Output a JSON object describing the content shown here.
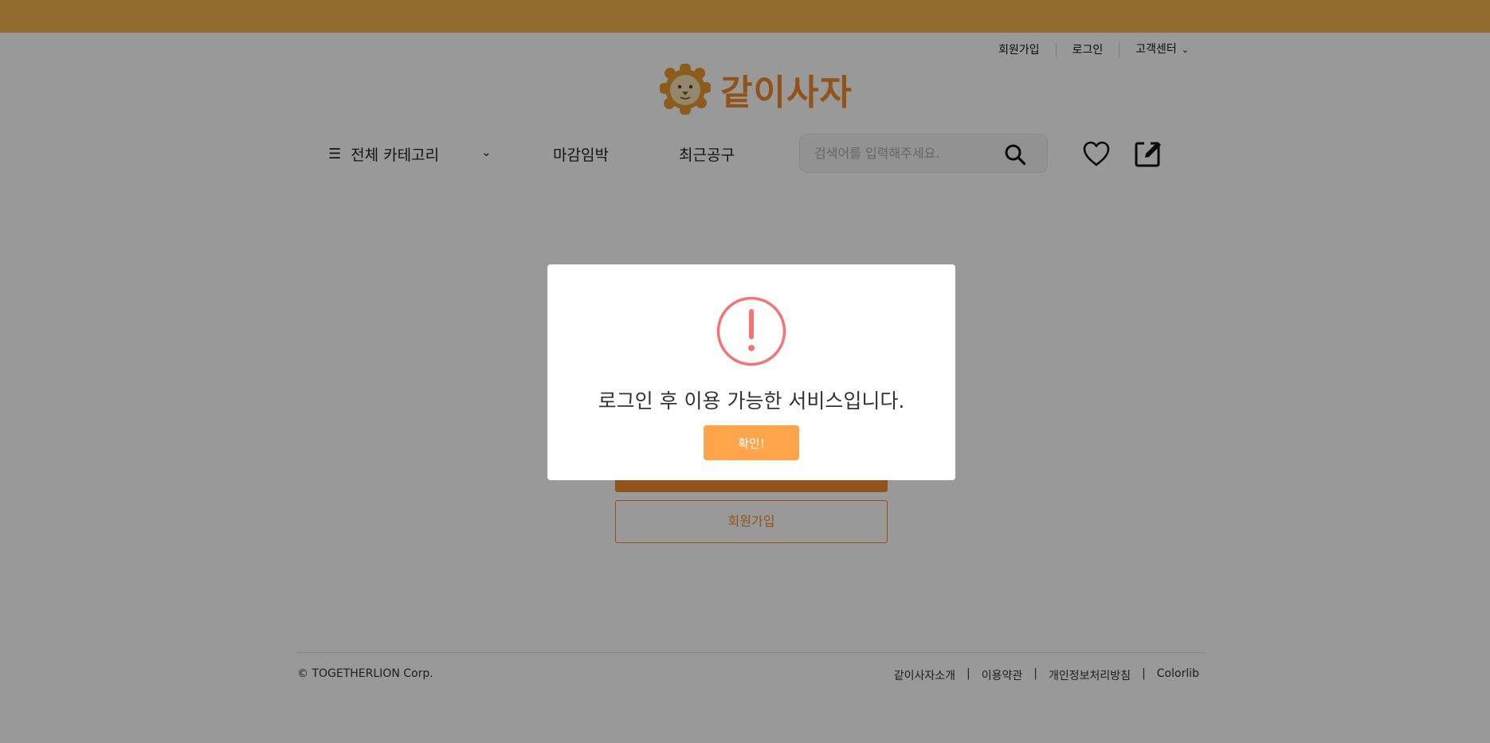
{
  "header": {
    "util_links": [
      "회원가입",
      "로그인",
      "고객센터"
    ],
    "logo_text": "같이사자"
  },
  "nav": {
    "category_label": "전체 카테고리",
    "menu": [
      "마감임박",
      "최근공구"
    ],
    "search_placeholder": "검색어를 입력해주세요."
  },
  "main": {
    "signup_label": "회원가입"
  },
  "footer": {
    "copyright": "© TOGETHERLION Corp.",
    "links": [
      "같이사자소개",
      "이용약관",
      "개인정보처리방침",
      "Colorlib"
    ]
  },
  "modal": {
    "message": "로그인 후 이용 가능한 서비스입니다.",
    "confirm_label": "확인!"
  },
  "colors": {
    "brand": "#f08b2a",
    "topbar": "#f2b24d",
    "confirm": "#fea54c",
    "warning": "#f27474"
  }
}
